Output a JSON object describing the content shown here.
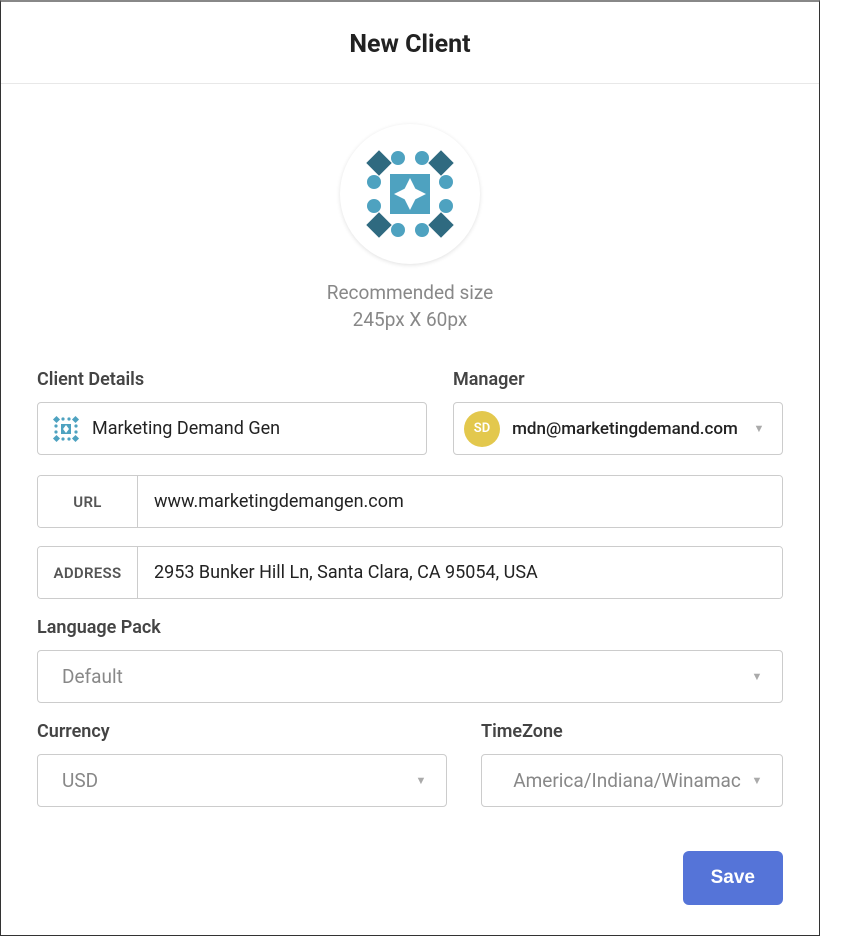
{
  "header": {
    "title": "New Client"
  },
  "logo": {
    "recommended_line1": "Recommended size",
    "recommended_line2": "245px X 60px"
  },
  "sections": {
    "client_details_label": "Client Details",
    "manager_label": "Manager",
    "language_label": "Language Pack",
    "currency_label": "Currency",
    "timezone_label": "TimeZone"
  },
  "fields": {
    "client_name": "Marketing Demand Gen",
    "manager_initials": "SD",
    "manager_email": "mdn@marketingdemand.com",
    "url_prefix": "URL",
    "url_value": "www.marketingdemangen.com",
    "address_prefix": "ADDRESS",
    "address_value": "2953 Bunker Hill Ln, Santa Clara, CA 95054, USA",
    "language_value": "Default",
    "currency_value": "USD",
    "timezone_value": "America/Indiana/Winamac"
  },
  "buttons": {
    "save": "Save"
  }
}
